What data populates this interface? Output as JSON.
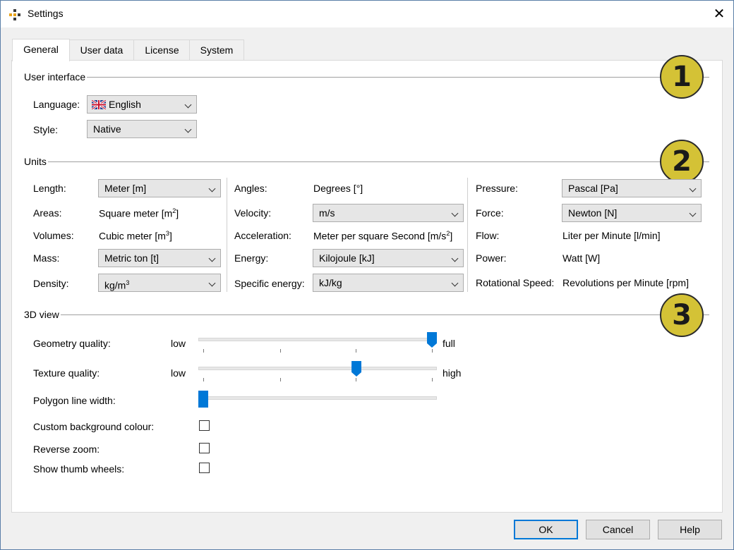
{
  "window": {
    "title": "Settings",
    "close_glyph": "✕"
  },
  "tabs": [
    "General",
    "User data",
    "License",
    "System"
  ],
  "sections": {
    "user_interface": {
      "label": "User interface",
      "badge": "1"
    },
    "units": {
      "label": "Units",
      "badge": "2"
    },
    "view3d": {
      "label": "3D view",
      "badge": "3"
    }
  },
  "ui": {
    "language": {
      "label": "Language:",
      "value": "English",
      "flag": "uk-flag-icon"
    },
    "style": {
      "label": "Style:",
      "value": "Native"
    }
  },
  "units": {
    "col1": {
      "length": {
        "label": "Length:",
        "value": "Meter [m]"
      },
      "areas": {
        "label": "Areas:",
        "value_main": "Square meter [m",
        "sup": "2",
        "value_end": "]"
      },
      "volumes": {
        "label": "Volumes:",
        "value_main": "Cubic meter [m",
        "sup": "3",
        "value_end": "]"
      },
      "mass": {
        "label": "Mass:",
        "value": "Metric ton [t]"
      },
      "density": {
        "label": "Density:",
        "value_main": "kg/m",
        "sup": "3"
      }
    },
    "col2": {
      "angles": {
        "label": "Angles:",
        "value": "Degrees [°]"
      },
      "velocity": {
        "label": "Velocity:",
        "value": "m/s"
      },
      "acceleration": {
        "label": "Acceleration:",
        "value_main": "Meter per square Second [m/s",
        "sup": "2",
        "value_end": "]"
      },
      "energy": {
        "label": "Energy:",
        "value": "Kilojoule [kJ]"
      },
      "specific_energy": {
        "label": "Specific energy:",
        "value": "kJ/kg"
      }
    },
    "col3": {
      "pressure": {
        "label": "Pressure:",
        "value": "Pascal [Pa]"
      },
      "force": {
        "label": "Force:",
        "value": "Newton [N]"
      },
      "flow": {
        "label": "Flow:",
        "value": "Liter per Minute [l/min]"
      },
      "power": {
        "label": "Power:",
        "value": "Watt [W]"
      },
      "rotational_speed": {
        "label": "Rotational Speed:",
        "value": "Revolutions per Minute [rpm]"
      }
    }
  },
  "view3d": {
    "geometry_quality": {
      "label": "Geometry quality:",
      "min_label": "low",
      "max_label": "full",
      "value_fraction": 1.0
    },
    "texture_quality": {
      "label": "Texture quality:",
      "min_label": "low",
      "max_label": "high",
      "value_fraction": 0.67
    },
    "polygon_line_width": {
      "label": "Polygon line width:",
      "value_fraction": 0.0
    },
    "custom_background": {
      "label": "Custom background colour:",
      "checked": false
    },
    "reverse_zoom": {
      "label": "Reverse zoom:",
      "checked": false
    },
    "thumb_wheels": {
      "label": "Show thumb wheels:",
      "checked": false
    }
  },
  "buttons": {
    "ok": "OK",
    "cancel": "Cancel",
    "help": "Help"
  },
  "colors": {
    "accent": "#0078d7",
    "badge": "#d4c236"
  }
}
